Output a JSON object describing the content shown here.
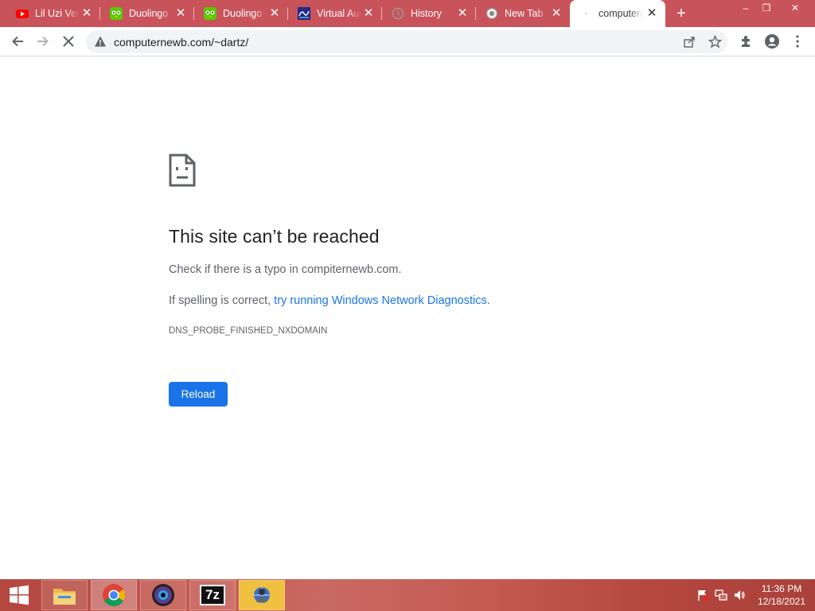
{
  "tabs": [
    {
      "title": "Lil Uzi Vert",
      "icon": "youtube-icon"
    },
    {
      "title": "Duolingo",
      "icon": "duolingo-icon"
    },
    {
      "title": "Duolingo",
      "icon": "duolingo-icon"
    },
    {
      "title": "Virtual Audio",
      "icon": "virtual-audio-icon"
    },
    {
      "title": "History",
      "icon": "history-icon"
    },
    {
      "title": "New Tab",
      "icon": "chrome-icon"
    },
    {
      "title": "computernewb",
      "icon": "loading-icon"
    }
  ],
  "window_controls": {
    "minimize": "–",
    "restore": "❐",
    "close": "✕"
  },
  "address_bar": {
    "url": "computernewb.com/~dartz/"
  },
  "error_page": {
    "title": "This site can’t be reached",
    "line1": "Check if there is a typo in compiternewb.com.",
    "line2_prefix": "If spelling is correct, ",
    "line2_link": "try running Windows Network Diagnostics",
    "line2_suffix": ".",
    "code": "DNS_PROBE_FINISHED_NXDOMAIN",
    "reload_label": "Reload"
  },
  "taskbar": {
    "apps": [
      "file-explorer-icon",
      "chrome-icon",
      "obs-icon",
      "7zip-icon",
      "network-app-icon"
    ],
    "sevenzip_label": "7z",
    "time": "11:36 PM",
    "date": "12/18/2021"
  },
  "colors": {
    "tabstrip": "#c9535a",
    "accent": "#1a73e8",
    "taskbar": "#b3463f"
  }
}
